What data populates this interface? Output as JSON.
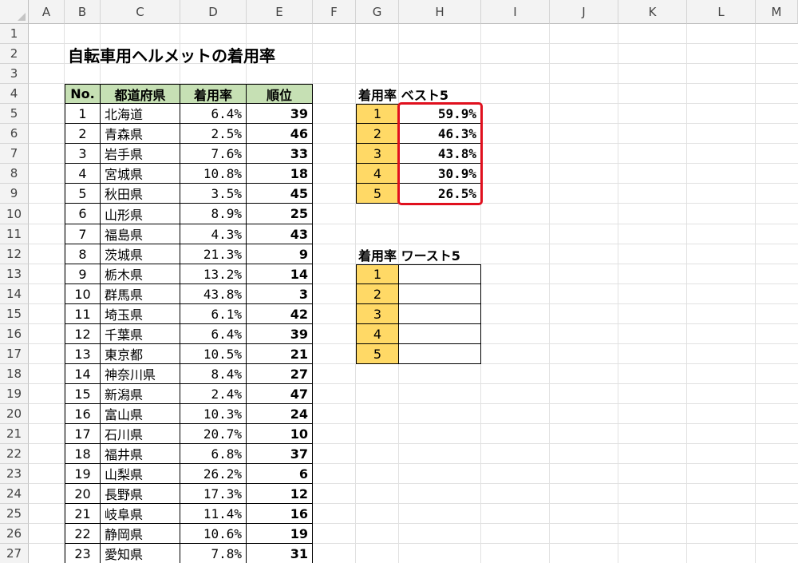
{
  "columns": [
    "A",
    "B",
    "C",
    "D",
    "E",
    "F",
    "G",
    "H",
    "I",
    "J",
    "K",
    "L",
    "M"
  ],
  "rows": [
    "1",
    "2",
    "3",
    "4",
    "5",
    "6",
    "7",
    "8",
    "9",
    "10",
    "11",
    "12",
    "13",
    "14",
    "15",
    "16",
    "17",
    "18",
    "19",
    "20",
    "21",
    "22",
    "23",
    "24",
    "25",
    "26",
    "27"
  ],
  "title": "自転車用ヘルメットの着用率",
  "main_table": {
    "headers": [
      "No.",
      "都道府県",
      "着用率",
      "順位"
    ],
    "rows": [
      [
        "1",
        "北海道",
        "6.4%",
        "39"
      ],
      [
        "2",
        "青森県",
        "2.5%",
        "46"
      ],
      [
        "3",
        "岩手県",
        "7.6%",
        "33"
      ],
      [
        "4",
        "宮城県",
        "10.8%",
        "18"
      ],
      [
        "5",
        "秋田県",
        "3.5%",
        "45"
      ],
      [
        "6",
        "山形県",
        "8.9%",
        "25"
      ],
      [
        "7",
        "福島県",
        "4.3%",
        "43"
      ],
      [
        "8",
        "茨城県",
        "21.3%",
        "9"
      ],
      [
        "9",
        "栃木県",
        "13.2%",
        "14"
      ],
      [
        "10",
        "群馬県",
        "43.8%",
        "3"
      ],
      [
        "11",
        "埼玉県",
        "6.1%",
        "42"
      ],
      [
        "12",
        "千葉県",
        "6.4%",
        "39"
      ],
      [
        "13",
        "東京都",
        "10.5%",
        "21"
      ],
      [
        "14",
        "神奈川県",
        "8.4%",
        "27"
      ],
      [
        "15",
        "新潟県",
        "2.4%",
        "47"
      ],
      [
        "16",
        "富山県",
        "10.3%",
        "24"
      ],
      [
        "17",
        "石川県",
        "20.7%",
        "10"
      ],
      [
        "18",
        "福井県",
        "6.8%",
        "37"
      ],
      [
        "19",
        "山梨県",
        "26.2%",
        "6"
      ],
      [
        "20",
        "長野県",
        "17.3%",
        "12"
      ],
      [
        "21",
        "岐阜県",
        "11.4%",
        "16"
      ],
      [
        "22",
        "静岡県",
        "10.6%",
        "19"
      ],
      [
        "23",
        "愛知県",
        "7.8%",
        "31"
      ]
    ]
  },
  "best5": {
    "label": "着用率 ベスト5",
    "ranks": [
      "1",
      "2",
      "3",
      "4",
      "5"
    ],
    "values": [
      "59.9%",
      "46.3%",
      "43.8%",
      "30.9%",
      "26.5%"
    ]
  },
  "worst5": {
    "label": "着用率 ワースト5",
    "ranks": [
      "1",
      "2",
      "3",
      "4",
      "5"
    ],
    "values": [
      "",
      "",
      "",
      "",
      ""
    ]
  },
  "colors": {
    "header_fill": "#c6e0b4",
    "rank_fill": "#ffd966",
    "highlight": "#e0101e"
  }
}
